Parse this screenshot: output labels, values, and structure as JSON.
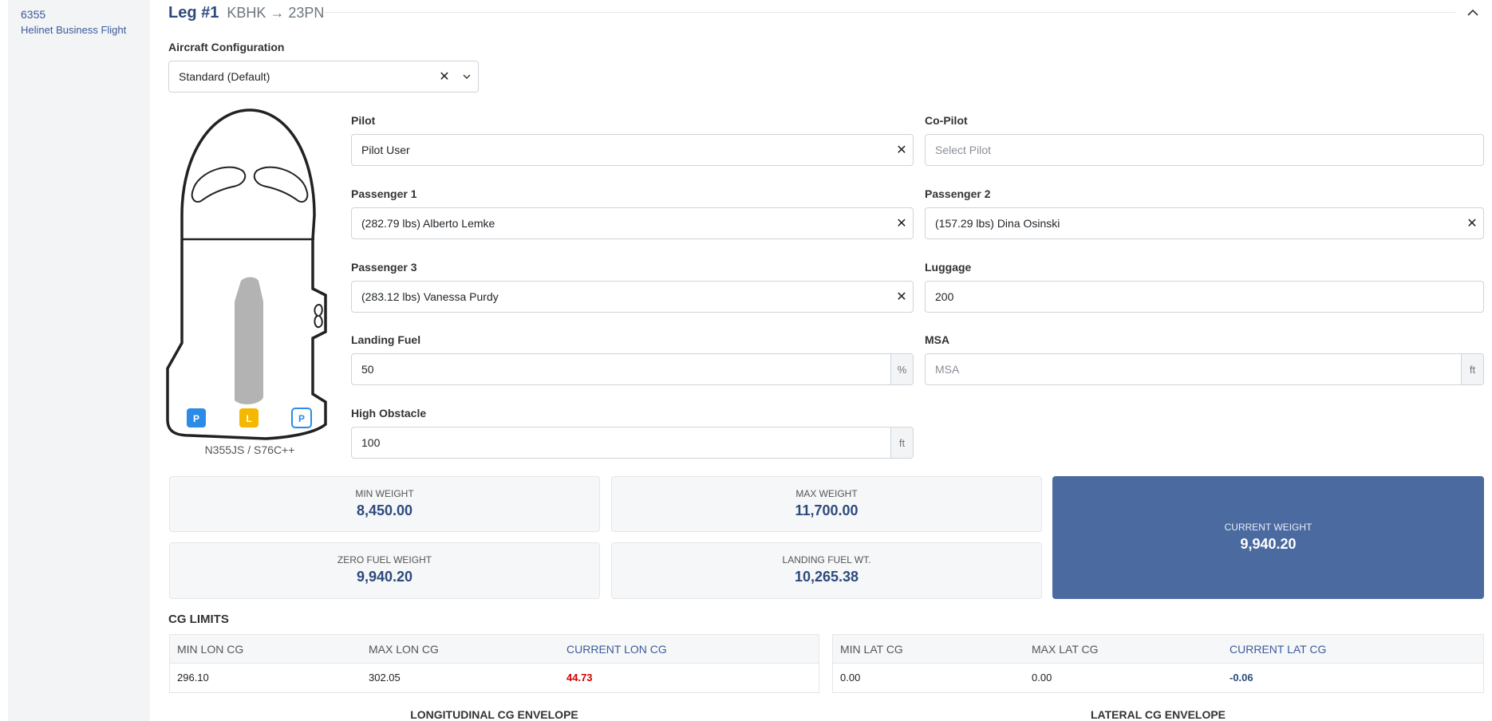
{
  "sidebar": {
    "flight_number": "6355",
    "flight_name": "Helinet Business Flight"
  },
  "leg": {
    "title": "Leg #1",
    "route": "KBHK → 23PN"
  },
  "aircraft_config": {
    "label": "Aircraft Configuration",
    "value": "Standard (Default)"
  },
  "aircraft": {
    "registration": "N355JS / S76C++",
    "seat_p1": "P",
    "seat_l": "L",
    "seat_p2": "P"
  },
  "fields": {
    "pilot": {
      "label": "Pilot",
      "value": "Pilot User"
    },
    "copilot": {
      "label": "Co-Pilot",
      "placeholder": "Select Pilot"
    },
    "passenger1": {
      "label": "Passenger 1",
      "value": "(282.79 lbs) Alberto Lemke"
    },
    "passenger2": {
      "label": "Passenger 2",
      "value": "(157.29 lbs) Dina Osinski"
    },
    "passenger3": {
      "label": "Passenger 3",
      "value": "(283.12 lbs) Vanessa Purdy"
    },
    "luggage": {
      "label": "Luggage",
      "value": "200"
    },
    "landing_fuel": {
      "label": "Landing Fuel",
      "value": "50",
      "unit": "%"
    },
    "msa": {
      "label": "MSA",
      "placeholder": "MSA",
      "unit": "ft"
    },
    "high_obstacle": {
      "label": "High Obstacle",
      "value": "100",
      "unit": "ft"
    }
  },
  "weights": {
    "min": {
      "label": "MIN WEIGHT",
      "value": "8,450.00"
    },
    "max": {
      "label": "MAX WEIGHT",
      "value": "11,700.00"
    },
    "current": {
      "label": "CURRENT WEIGHT",
      "value": "9,940.20"
    },
    "zero_fuel": {
      "label": "ZERO FUEL WEIGHT",
      "value": "9,940.20"
    },
    "landing_fuel": {
      "label": "LANDING FUEL WT.",
      "value": "10,265.38"
    }
  },
  "cg": {
    "title": "CG LIMITS",
    "lon": {
      "headers": [
        "MIN LON CG",
        "MAX LON CG",
        "CURRENT LON CG"
      ],
      "values": [
        "296.10",
        "302.05",
        "44.73"
      ]
    },
    "lat": {
      "headers": [
        "MIN LAT CG",
        "MAX LAT CG",
        "CURRENT LAT CG"
      ],
      "values": [
        "0.00",
        "0.00",
        "-0.06"
      ]
    },
    "lon_envelope_title": "LONGITUDINAL CG ENVELOPE",
    "lat_envelope_title": "LATERAL CG ENVELOPE"
  },
  "colors": {
    "accent": "#2d4a7c",
    "current_tile": "#4a6aa0",
    "danger": "#d00000",
    "seat_blue": "#2b8be6",
    "seat_yellow": "#f5b800"
  }
}
